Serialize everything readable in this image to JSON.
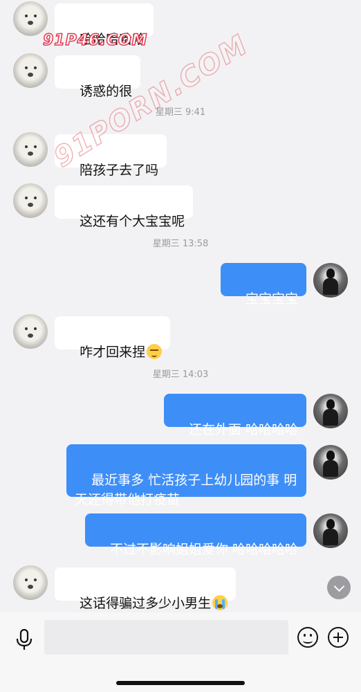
{
  "watermarks": {
    "top": "91P46.COM",
    "diagonal": "91PORN.COM"
  },
  "messages": [
    {
      "side": "left",
      "text": "哈哈哈哈哈"
    },
    {
      "side": "left",
      "text": "诱惑的很"
    },
    {
      "timestamp": "星期三 9:41"
    },
    {
      "side": "left",
      "text": "陪孩子去了吗"
    },
    {
      "side": "left",
      "text": "这还有个大宝宝呢"
    },
    {
      "timestamp": "星期三 13:58"
    },
    {
      "side": "right",
      "text": "宝宝宝宝"
    },
    {
      "side": "left",
      "text": "咋才回来捏",
      "emoji": "smirking-face"
    },
    {
      "timestamp": "星期三 14:03"
    },
    {
      "side": "right",
      "text": "还在外面 哈哈哈哈"
    },
    {
      "side": "right",
      "text": "最近事多 忙活孩子上幼儿园的事 明\n天还得带他打疫苗"
    },
    {
      "side": "right",
      "text": "不过不影响姐姐爱你 哈哈哈哈哈"
    },
    {
      "side": "left",
      "text": "这话得骗过多少小男生",
      "emoji": "loudly-crying-face"
    }
  ],
  "input_bar": {
    "voice_icon": "microphone-icon",
    "text_value": "",
    "emoji_icon": "smiley-icon",
    "more_icon": "plus-circle-icon"
  },
  "colors": {
    "background": "#f2f2f4",
    "bubble_incoming": "#ffffff",
    "bubble_outgoing": "#3e8ef7",
    "timestamp_text": "#9a9a9f"
  }
}
